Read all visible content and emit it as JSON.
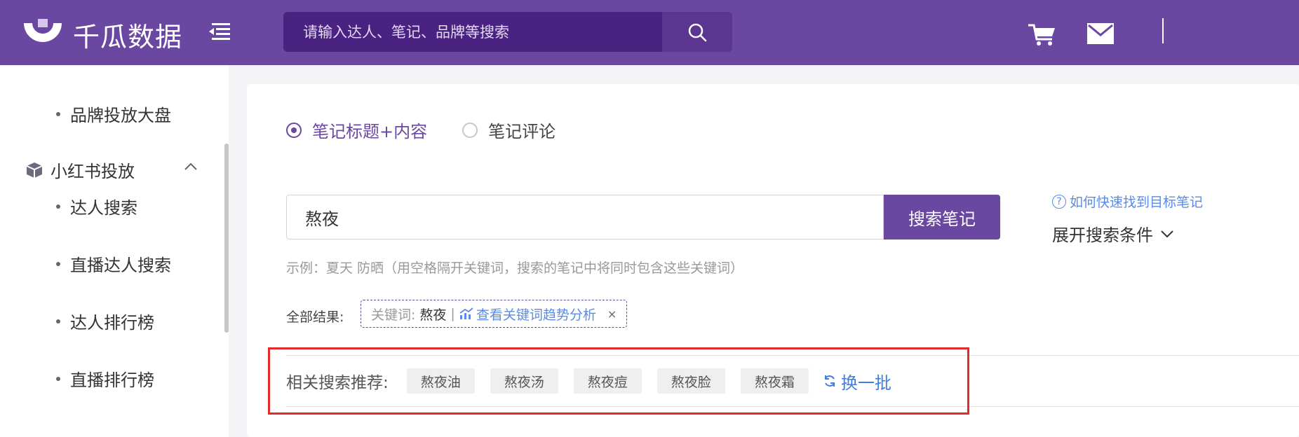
{
  "header": {
    "logo_text": "千瓜数据",
    "search_placeholder": "请输入达人、笔记、品牌等搜索",
    "icons": [
      "menu-toggle-icon",
      "search-icon",
      "cart-icon",
      "mail-icon"
    ],
    "colors": {
      "header_bg": "#6a47a0",
      "search_bg": "#4a2282"
    }
  },
  "sidebar": {
    "items_top": [
      {
        "label": "品牌投放大盘"
      }
    ],
    "group": {
      "label": "小红书投放",
      "expanded": true
    },
    "items": [
      {
        "label": "达人搜索"
      },
      {
        "label": "直播达人搜索"
      },
      {
        "label": "达人排行榜"
      },
      {
        "label": "直播排行榜"
      }
    ]
  },
  "main": {
    "radios": [
      {
        "label": "笔记标题+内容",
        "checked": true
      },
      {
        "label": "笔记评论",
        "checked": false
      }
    ],
    "keyword_value": "熬夜",
    "search_button": "搜索笔记",
    "help_link": "如何快速找到目标笔记",
    "expand_label": "展开搜索条件",
    "example": "示例：夏天 防晒（用空格隔开关键词，搜索的笔记中将同时包含这些关键词）",
    "results_label": "全部结果:",
    "filter_tag": {
      "key": "关键词:",
      "value": "熬夜",
      "separator": "|",
      "trend_link": "查看关键词趋势分析",
      "close": "×"
    },
    "related": {
      "label": "相关搜索推荐:",
      "chips": [
        "熬夜油",
        "熬夜汤",
        "熬夜痘",
        "熬夜脸",
        "熬夜霜"
      ],
      "refresh": "换一批"
    },
    "colors": {
      "accent": "#6a47a0",
      "link": "#5a8be6",
      "highlight_box": "#e02b2b"
    }
  }
}
